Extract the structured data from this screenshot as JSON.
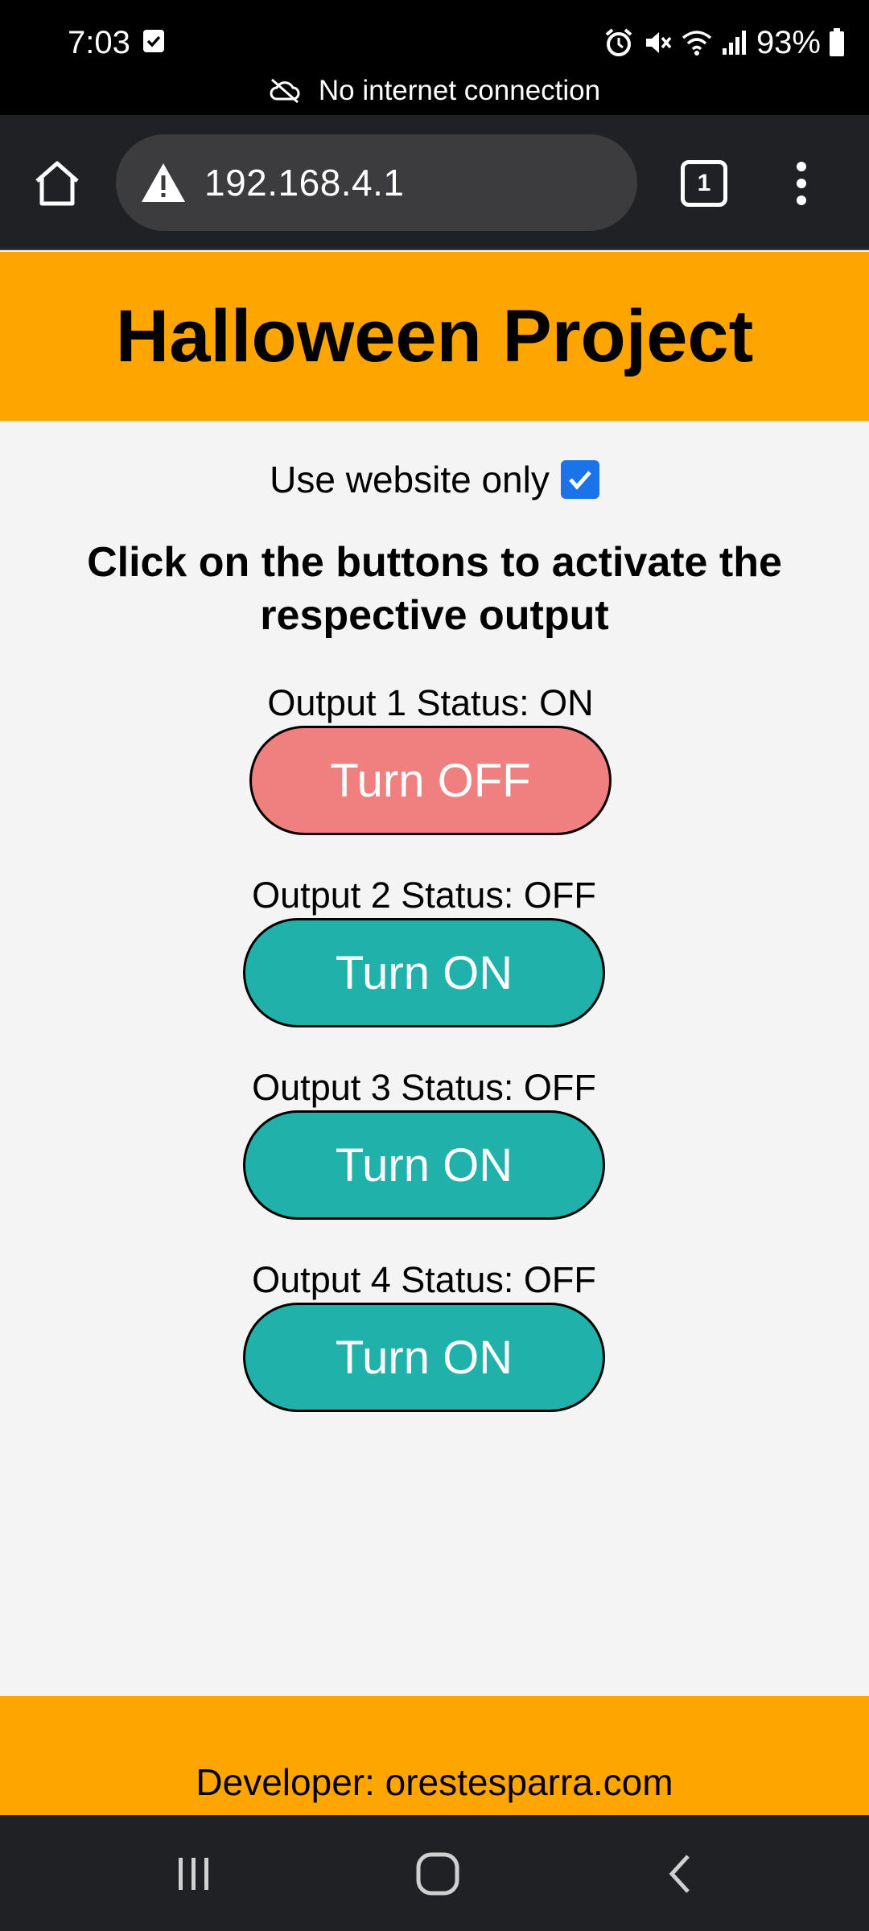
{
  "status_bar": {
    "time": "7:03",
    "battery": "93%"
  },
  "banner": {
    "text": "No internet connection"
  },
  "browser": {
    "url": "192.168.4.1",
    "tab_count": "1"
  },
  "header": {
    "title": "Halloween Project"
  },
  "main": {
    "website_only_label": "Use website only",
    "website_only_checked": true,
    "instructions": "Click on the buttons to activate the respective output",
    "outputs": [
      {
        "status": "Output 1 Status: ON",
        "button": "Turn OFF"
      },
      {
        "status": "Output 2 Status: OFF",
        "button": "Turn ON"
      },
      {
        "status": "Output 3 Status: OFF",
        "button": "Turn ON"
      },
      {
        "status": "Output 4 Status: OFF",
        "button": "Turn ON"
      }
    ]
  },
  "footer": {
    "text": "Developer: orestesparra.com"
  },
  "colors": {
    "header_bg": "#ffa500",
    "button_off_state": "#f08080",
    "button_on_state": "#20b2aa"
  }
}
